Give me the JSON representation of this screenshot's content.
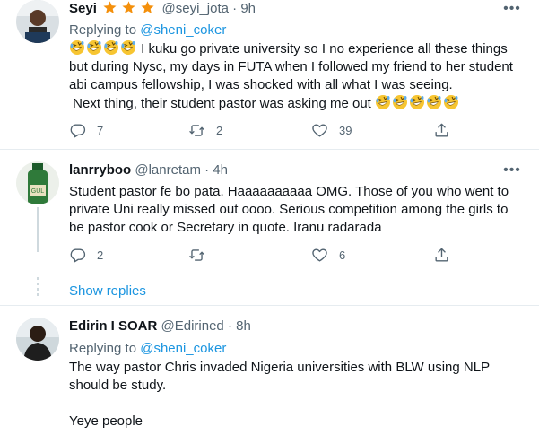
{
  "tweets": [
    {
      "name": "Seyi",
      "handle": "@seyi_jota",
      "dot": "·",
      "time": "9h",
      "replying_prefix": "Replying to ",
      "replying_to": "@sheni_coker",
      "line1": " I kuku go private university so I no experience all these things",
      "line2": "but during Nysc, my days in FUTA when I followed my friend to her student",
      "line3": "abi campus fellowship, I was shocked with all what I was seeing.",
      "line4": " Next thing, their student pastor was asking me out ",
      "replies": "7",
      "retweets": "2",
      "likes": "39"
    },
    {
      "name": "lanrryboo",
      "handle": "@lanretam",
      "dot": "·",
      "time": "4h",
      "line1": "Student pastor fe bo pata. Haaaaaaaaaa OMG. Those of you who went to",
      "line2": "private Uni really missed out oooo. Serious competition among the girls to",
      "line3": "be pastor cook or Secretary in quote. Iranu radarada",
      "replies": "2",
      "retweets": "",
      "likes": "6",
      "show_replies": "Show replies"
    },
    {
      "name": "Edirin I SOAR",
      "handle": "@Edirined",
      "dot": "·",
      "time": "8h",
      "replying_prefix": "Replying to ",
      "replying_to": "@sheni_coker",
      "line1": "The way pastor Chris invaded Nigeria universities with BLW using NLP",
      "line2": "should be study.",
      "line3": "Yeye people"
    }
  ],
  "icons": {
    "reply": "reply-icon",
    "retweet": "retweet-icon",
    "like": "heart-icon",
    "share": "share-icon",
    "more": "more-icon",
    "emoji": "rolling-laughing-emoji"
  },
  "colors": {
    "link": "#1b95e0",
    "secondary_text": "#536471",
    "divider": "#e6ecf0",
    "emoji_face": "#f7c531",
    "badge": "#f4900c"
  }
}
